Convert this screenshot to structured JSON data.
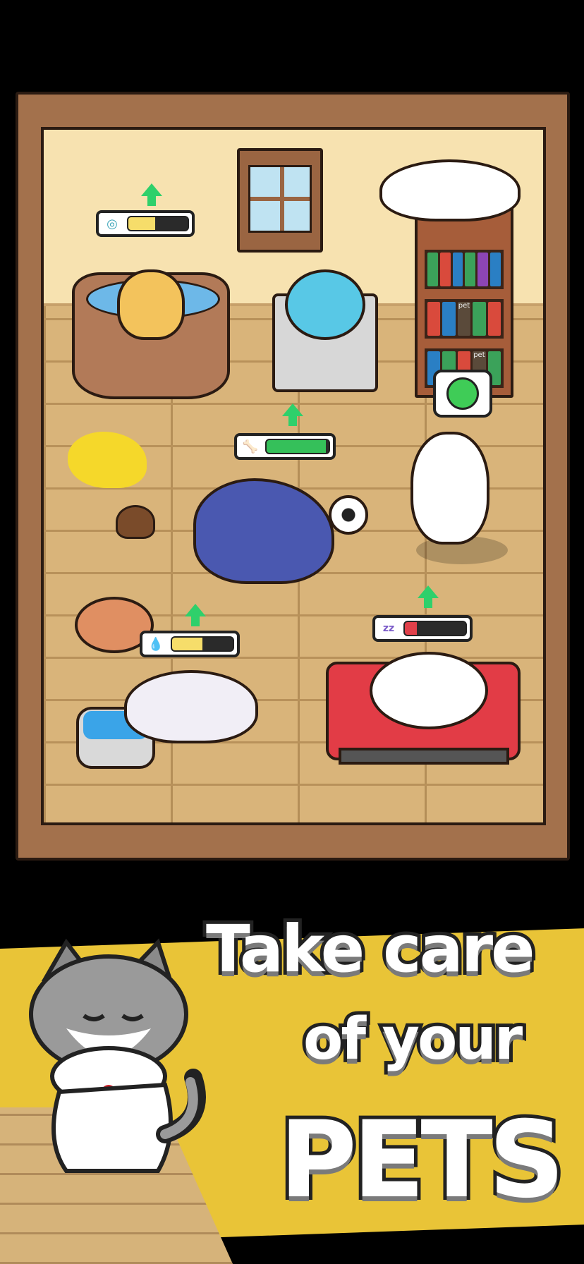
{
  "promo": {
    "line1": "Take care",
    "line2": "of your",
    "line3": "PETS"
  },
  "shelf_labels": [
    "pet",
    "pet"
  ],
  "status_bubbles": [
    {
      "pet": "dog-in-tub",
      "need_icon": "bubbles-icon",
      "level": 0.45,
      "fill_color": "#f6dd6a",
      "trend": "up"
    },
    {
      "pet": "husky",
      "need_icon": "bone-icon",
      "level": 0.95,
      "fill_color": "#35c05a",
      "trend": "up"
    },
    {
      "pet": "guinea-pig",
      "need_icon": "water-drop-icon",
      "level": 0.5,
      "fill_color": "#f6dd6a",
      "trend": "up"
    },
    {
      "pet": "sleeping-dog",
      "need_icon": "sleep-zzz-icon",
      "level": 0.2,
      "fill_color": "#e0404a",
      "trend": "up"
    }
  ],
  "panda_mood": "happy-face-icon",
  "colors": {
    "frame": "#a3714c",
    "wall": "#f7e2b0",
    "floor": "#d9b47a",
    "promo_band": "#e9c437",
    "arrow": "#2fd06b"
  }
}
